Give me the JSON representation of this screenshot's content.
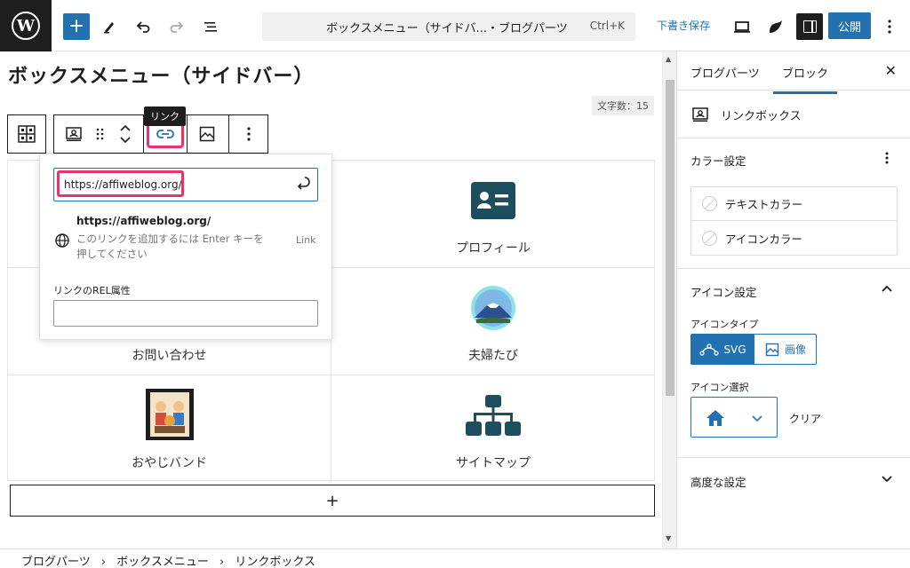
{
  "topbar": {
    "doc_title": "ボックスメニュー（サイドバ...・ブログパーツ",
    "shortcut": "Ctrl+K",
    "save_draft": "下書き保存",
    "publish": "公開"
  },
  "editor": {
    "title": "ボックスメニュー（サイドバー）",
    "word_count": "文字数：15",
    "tooltip": "リンク",
    "boxes": [
      {
        "label": ""
      },
      {
        "label": "プロフィール"
      },
      {
        "label": "お問い合わせ"
      },
      {
        "label": "夫婦たび"
      },
      {
        "label": "おやじバンド"
      },
      {
        "label": "サイトマップ"
      }
    ],
    "add_symbol": "+"
  },
  "link_popover": {
    "url_value": "https://affiweblog.org/",
    "suggestion_url": "https://affiweblog.org/",
    "suggestion_info": "このリンクを追加するには Enter キーを押してください",
    "suggestion_type": "Link",
    "rel_label": "リンクのREL属性",
    "rel_value": ""
  },
  "sidebar": {
    "tabs": [
      "ブログパーツ",
      "ブロック"
    ],
    "active_tab": "ブロック",
    "block_name": "リンクボックス",
    "color_section": "カラー設定",
    "color_items": [
      "テキストカラー",
      "アイコンカラー"
    ],
    "icon_section": "アイコン設定",
    "icon_type_label": "アイコンタイプ",
    "icon_type_options": [
      "SVG",
      "画像"
    ],
    "icon_type_selected": "SVG",
    "icon_select_label": "アイコン選択",
    "clear": "クリア",
    "advanced": "高度な設定"
  },
  "breadcrumb": [
    "ブログパーツ",
    "ボックスメニュー",
    "リンクボックス"
  ],
  "colors": {
    "accent": "#2271b1",
    "highlight": "#e8336f",
    "icon_dark": "#1d4e5e"
  }
}
